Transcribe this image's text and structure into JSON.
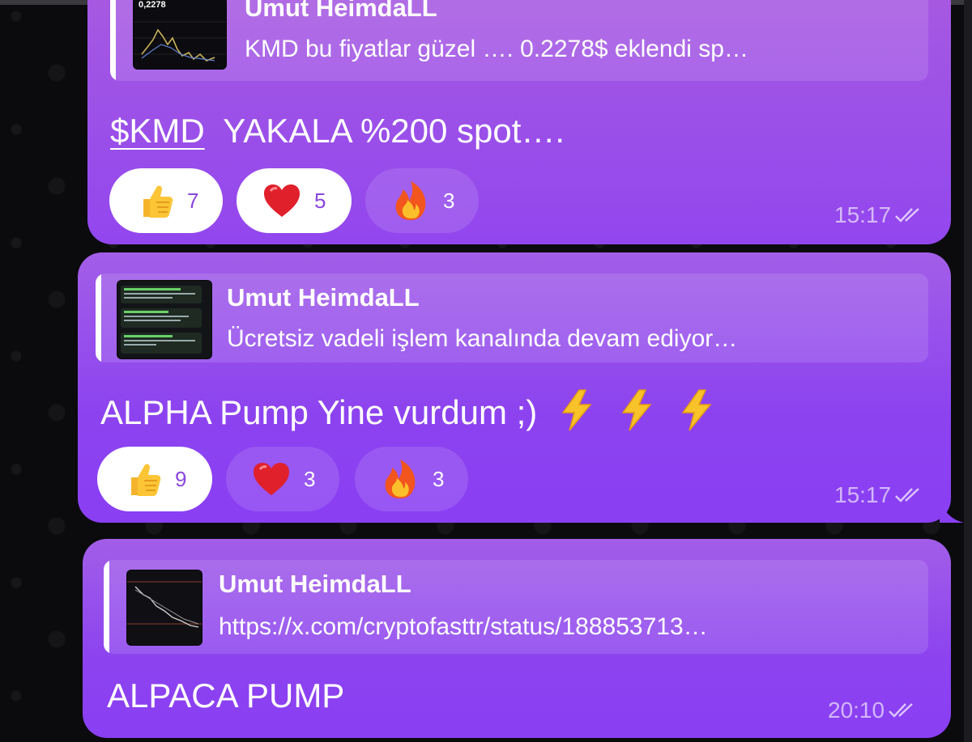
{
  "messages": [
    {
      "reply": {
        "author": "Umut HeimdaLL",
        "text": "KMD bu fiyatlar güzel …. 0.2278$ eklendi sp…",
        "thumb_price": "0,2278"
      },
      "text_ticker": "$KMD",
      "text_rest": "YAKALA %200 spot….",
      "reactions": [
        {
          "emoji": "thumbs-up",
          "count": "7"
        },
        {
          "emoji": "heart",
          "count": "5"
        },
        {
          "emoji": "fire",
          "count": "3"
        }
      ],
      "time": "15:17"
    },
    {
      "reply": {
        "author": "Umut HeimdaLL",
        "text": "Ücretsiz vadeli işlem kanalında devam ediyor…"
      },
      "text": "ALPHA Pump Yine vurdum ;)",
      "reactions": [
        {
          "emoji": "thumbs-up",
          "count": "9"
        },
        {
          "emoji": "heart",
          "count": "3"
        },
        {
          "emoji": "fire",
          "count": "3"
        }
      ],
      "time": "15:17"
    },
    {
      "reply": {
        "author": "Umut HeimdaLL",
        "text": "https://x.com/cryptofasttr/status/188853713…"
      },
      "text": "ALPACA PUMP",
      "time": "20:10"
    }
  ],
  "colors": {
    "bubble": "#8c43ef",
    "reaction_selected": "#ffffff",
    "count_selected": "#8a47dd"
  }
}
